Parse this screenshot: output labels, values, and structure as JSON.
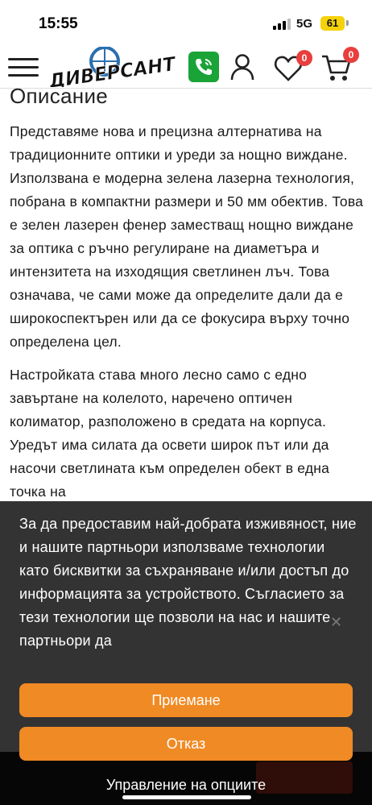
{
  "status_bar": {
    "time": "15:55",
    "network": "5G",
    "battery": "61"
  },
  "header": {
    "logo_text": "ДИВЕРСАНТ",
    "wishlist_count": "0",
    "cart_count": "0",
    "icons": [
      "menu-icon",
      "phone-icon",
      "user-icon",
      "heart-icon",
      "cart-icon"
    ],
    "colors": {
      "phone": "#1aa337",
      "badge": "#e83e3e"
    }
  },
  "description": {
    "title": "Описание",
    "paragraphs": [
      "Представяме нова и прецизна алтернатива на традиционните оптики и уреди за нощно виждане. Използвана е модерна зелена лазерна технология, побрана в компактни размери и 50 мм обектив. Това е зелен лазерен фенер заместващ нощно виждане за оптика с ръчно регулиране на диаметъра и интензитета на изходящия светлинен лъч. Това означава, че сами може да определите дали да е широкоспектърен или да се фокусира върху точно определена цел.",
      "Настройката става много лесно само с едно завъртане на колелото, наречено оптичен колиматор, разположено в средата на корпуса. Уредът има силата да освети широк път или да насочи светлината към определен обект в една точка на"
    ]
  },
  "cookie_banner": {
    "text": "За да предоставим най-добрата изживяност, ние и нашите партньори използваме технологии като бисквитки за съхраняване и/или достъп до информацията за устройството. Съгласието за тези технологии ще позволи на нас и нашите партньори да",
    "accept_label": "Приемане",
    "reject_label": "Отказ",
    "manage_label": "Управление на опциите",
    "button_color": "#f08a24"
  }
}
